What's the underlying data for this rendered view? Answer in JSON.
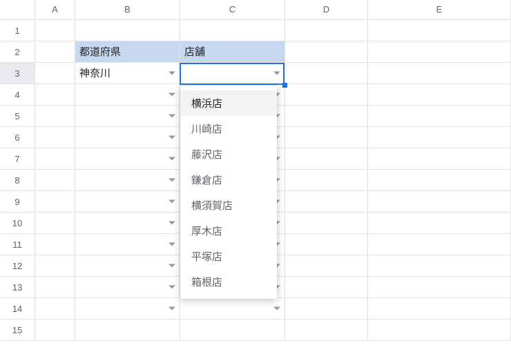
{
  "columns": [
    "A",
    "B",
    "C",
    "D",
    "E"
  ],
  "rowCount": 15,
  "headerRow": 2,
  "headers": {
    "B": "都道府県",
    "C": "店舗"
  },
  "cells": {
    "B3": "神奈川"
  },
  "dropdownColumns": [
    "B",
    "C"
  ],
  "dropdownRows": [
    3,
    4,
    5,
    6,
    7,
    8,
    9,
    10,
    11,
    12,
    13,
    14
  ],
  "activeCell": {
    "col": "C",
    "row": 3
  },
  "dropdown": {
    "open": true,
    "highlightIndex": 0,
    "items": [
      "横浜店",
      "川崎店",
      "藤沢店",
      "鎌倉店",
      "横須賀店",
      "厚木店",
      "平塚店",
      "箱根店"
    ]
  }
}
